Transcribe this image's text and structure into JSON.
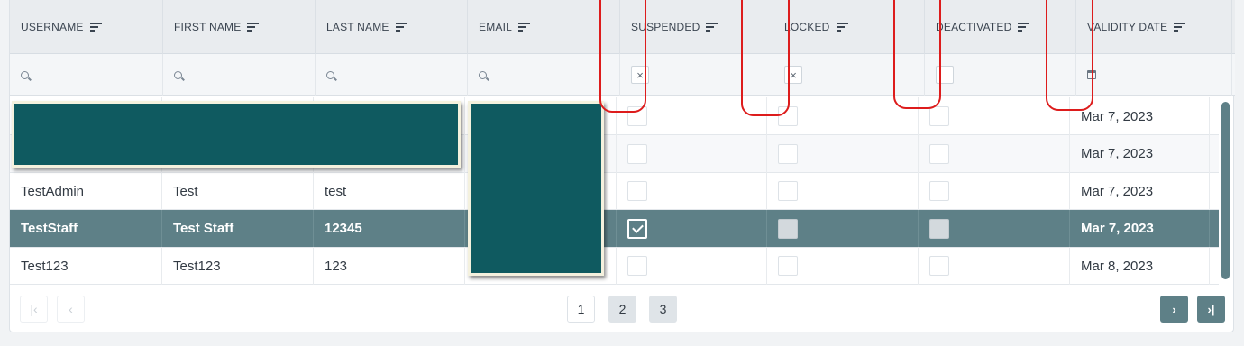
{
  "table": {
    "columns": [
      {
        "label": "USERNAME",
        "key": "username",
        "filter": "search"
      },
      {
        "label": "FIRST NAME",
        "key": "first_name",
        "filter": "search"
      },
      {
        "label": "LAST NAME",
        "key": "last_name",
        "filter": "search"
      },
      {
        "label": "EMAIL",
        "key": "email",
        "filter": "search"
      },
      {
        "label": "SUSPENDED",
        "key": "suspended",
        "filter": "checkbox-x"
      },
      {
        "label": "LOCKED",
        "key": "locked",
        "filter": "checkbox-x"
      },
      {
        "label": "DEACTIVATED",
        "key": "deactivated",
        "filter": "checkbox-empty"
      },
      {
        "label": "VALIDITY DATE",
        "key": "validity_date",
        "filter": "calendar"
      }
    ],
    "filter_values": {
      "suspended": "×",
      "locked": "×"
    },
    "rows": [
      {
        "username": "",
        "first_name": "",
        "last_name": "",
        "suspended": false,
        "locked": false,
        "deactivated": false,
        "validity_date": "Mar 7, 2023",
        "selected": false
      },
      {
        "username": "",
        "first_name": "",
        "last_name": "",
        "suspended": false,
        "locked": false,
        "deactivated": false,
        "validity_date": "Mar 7, 2023",
        "selected": false
      },
      {
        "username": "TestAdmin",
        "first_name": "Test",
        "last_name": "test",
        "suspended": false,
        "locked": false,
        "deactivated": false,
        "validity_date": "Mar 7, 2023",
        "selected": false
      },
      {
        "username": "TestStaff",
        "first_name": "Test Staff",
        "last_name": "12345",
        "suspended": true,
        "locked": false,
        "deactivated": false,
        "validity_date": "Mar 7, 2023",
        "selected": true
      },
      {
        "username": "Test123",
        "first_name": "Test123",
        "last_name": "123",
        "suspended": false,
        "locked": false,
        "deactivated": false,
        "validity_date": "Mar 8, 2023",
        "selected": false
      }
    ]
  },
  "pagination": {
    "pages": [
      "1",
      "2",
      "3"
    ],
    "current_page": "1",
    "first_icon": "first-page-icon",
    "prev_icon": "prev-page-icon",
    "next_icon": "next-page-icon",
    "last_icon": "last-page-icon"
  },
  "colors": {
    "accent": "#5e8087",
    "redaction": "#0f5a60",
    "annotation": "#dd1c1c"
  }
}
